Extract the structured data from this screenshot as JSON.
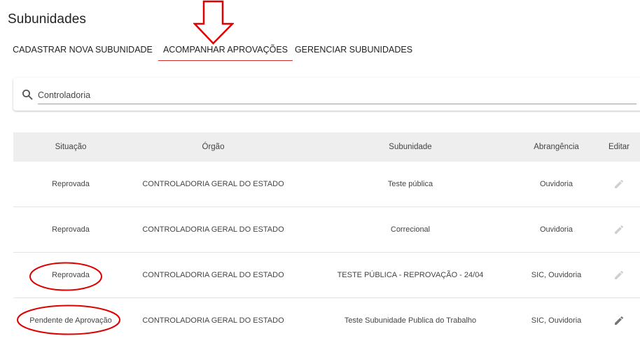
{
  "page": {
    "title": "Subunidades"
  },
  "tabs": [
    {
      "label": "CADASTRAR NOVA SUBUNIDADE",
      "active": false
    },
    {
      "label": "ACOMPANHAR APROVAÇÕES",
      "active": true
    },
    {
      "label": "GERENCIAR SUBUNIDADES",
      "active": false
    }
  ],
  "search": {
    "value": "Controladoria",
    "icon": "search-icon"
  },
  "table": {
    "headers": [
      "Situação",
      "Órgão",
      "Subunidade",
      "Abrangência",
      "Editar"
    ],
    "rows": [
      {
        "situacao": "Reprovada",
        "orgao": "CONTROLADORIA GERAL DO ESTADO",
        "subunidade": "Teste pública",
        "abrangencia": "Ouvidoria",
        "edit_enabled": false
      },
      {
        "situacao": "Reprovada",
        "orgao": "CONTROLADORIA GERAL DO ESTADO",
        "subunidade": "Correcional",
        "abrangencia": "Ouvidoria",
        "edit_enabled": false
      },
      {
        "situacao": "Reprovada",
        "orgao": "CONTROLADORIA GERAL DO ESTADO",
        "subunidade": "TESTE PÚBLICA - REPROVAÇÃO - 24/04",
        "abrangencia": "SIC, Ouvidoria",
        "edit_enabled": false
      },
      {
        "situacao": "Pendente de Aprovação",
        "orgao": "CONTROLADORIA GERAL DO ESTADO",
        "subunidade": "Teste Subunidade Publica do Trabalho",
        "abrangencia": "SIC, Ouvidoria",
        "edit_enabled": true
      }
    ]
  },
  "colors": {
    "active_tab_underline": "#d32f2f",
    "annotation": "#e00000",
    "header_bg": "#eeeeee"
  }
}
